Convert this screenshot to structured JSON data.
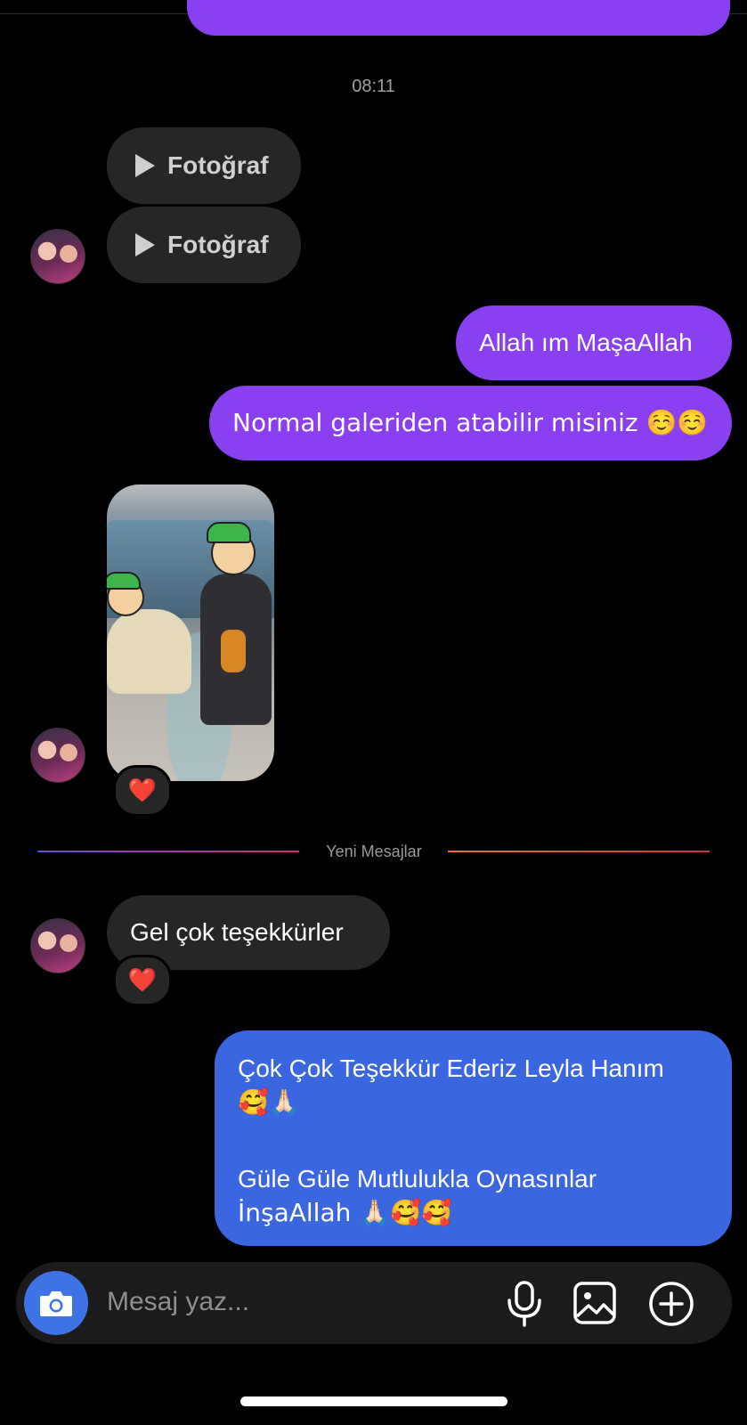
{
  "timestamp": "08:11",
  "messages": {
    "media_1": {
      "label": "Fotoğraf"
    },
    "media_2": {
      "label": "Fotoğraf"
    },
    "sent_1": "Allah ım MaşaAllah",
    "sent_2": "Normal galeriden atabilir misiniz ☺️☺️",
    "photo_reaction": "❤️",
    "received_1": "Gel çok teşekkürler",
    "received_1_reaction": "❤️",
    "sent_3_line1": "Çok Çok Teşekkür Ederiz Leyla Hanım",
    "sent_3_line2": "🥰🙏🏻",
    "sent_3_line3": "Güle Güle Mutlulukla Oynasınlar",
    "sent_3_line4": "İnşaAllah 🙏🏻🥰🥰"
  },
  "divider": {
    "label": "Yeni Mesajlar"
  },
  "composer": {
    "placeholder": "Mesaj yaz...",
    "icons": [
      "camera-icon",
      "microphone-icon",
      "gallery-icon",
      "add-circle-icon"
    ]
  },
  "colors": {
    "sent_purple": "#8a3ff0",
    "sent_blue": "#3a66e0",
    "received_gray": "#262626",
    "camera_button": "#3e73e6"
  }
}
